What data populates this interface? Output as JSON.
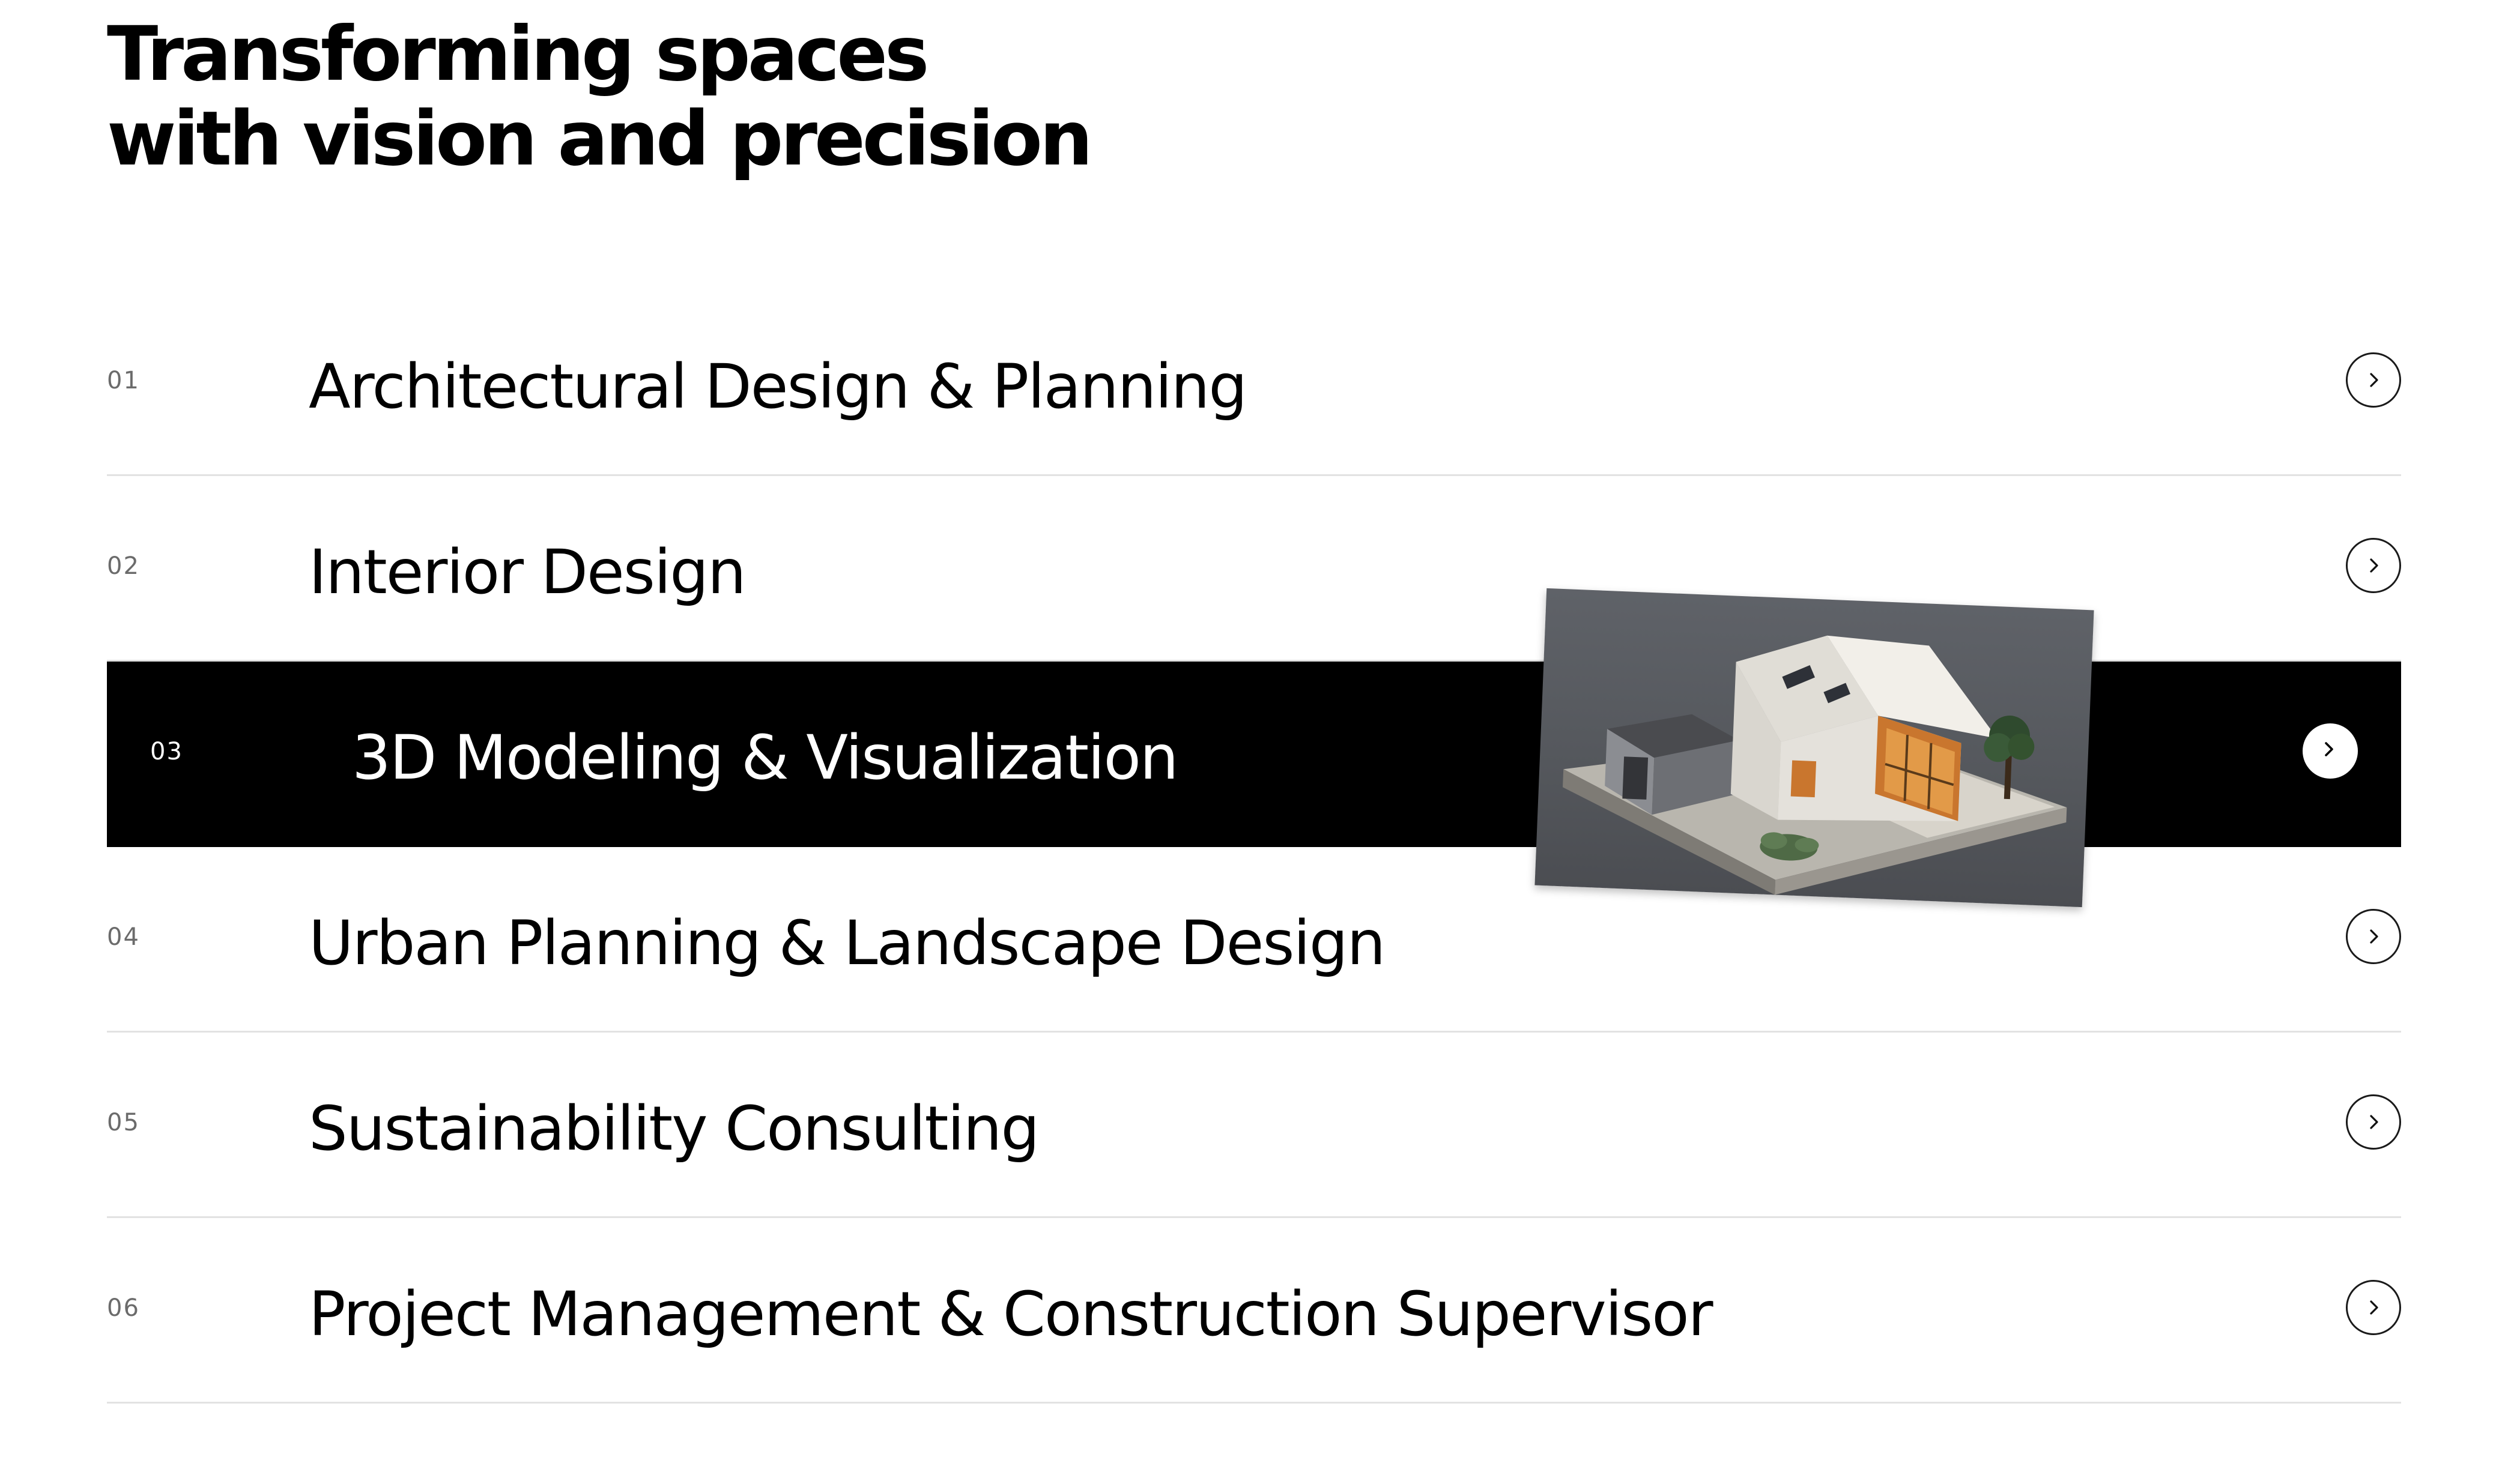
{
  "headline": {
    "line1": "Transforming spaces",
    "line2": "with vision and precision"
  },
  "services": [
    {
      "number": "01",
      "title": "Architectural Design & Planning",
      "active": false
    },
    {
      "number": "02",
      "title": "Interior Design",
      "active": false
    },
    {
      "number": "03",
      "title": "3D Modeling & Visualization",
      "active": true
    },
    {
      "number": "04",
      "title": "Urban Planning & Landscape Design",
      "active": false
    },
    {
      "number": "05",
      "title": "Sustainability Consulting",
      "active": false
    },
    {
      "number": "06",
      "title": "Project Management & Construction Supervisor",
      "active": false
    }
  ],
  "icons": {
    "row_arrow": "chevron-right-icon",
    "preview": "isometric-house-illustration"
  },
  "colors": {
    "background": "#ffffff",
    "text": "#000000",
    "active_row_background": "#000000",
    "active_row_text": "#ffffff",
    "divider": "#e2e2e2",
    "number_muted": "#6b6b6b"
  }
}
